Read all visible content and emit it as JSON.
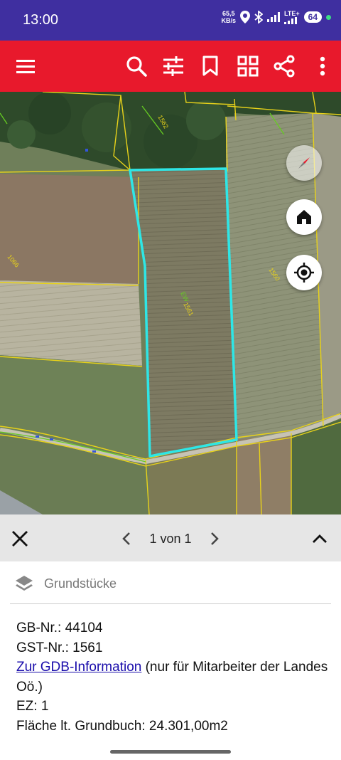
{
  "status": {
    "time": "13:00",
    "speed_value": "65,5",
    "speed_unit": "KB/s",
    "network": "LTE+",
    "battery": "64"
  },
  "toolbar": {
    "icons": [
      "menu-icon",
      "search-icon",
      "tune-icon",
      "bookmark-icon",
      "grid-icon",
      "share-icon",
      "more-vert-icon"
    ]
  },
  "map": {
    "parcel_number": "1561",
    "labels": [
      {
        "text": "1562"
      },
      {
        "text": "1066"
      },
      {
        "text": "1560"
      },
      {
        "text": "EW"
      }
    ],
    "colors": {
      "highlight": "#2ee6e6",
      "boundary": "#e8d21a",
      "label": "#66cc22"
    }
  },
  "panel": {
    "pager_text": "1 von 1",
    "layer_name": "Grundstücke",
    "gb_line": "GB-Nr.: 44104",
    "gst_line": "GST-Nr.: 1561",
    "link_text": "Zur GDB-Information",
    "link_suffix": " (nur für Mitarbeiter der Landes Oö.)",
    "ez_line": "EZ: 1",
    "flaeche_line": "Fläche lt. Grundbuch: 24.301,00m2"
  }
}
